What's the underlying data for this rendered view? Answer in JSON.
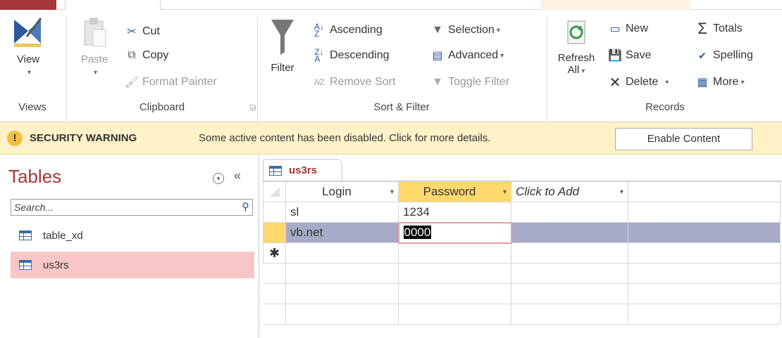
{
  "ribbon": {
    "groups": {
      "views": "Views",
      "clipboard": "Clipboard",
      "sort_filter": "Sort & Filter",
      "records": "Records"
    },
    "views": {
      "view_label": "View"
    },
    "clipboard": {
      "paste_label": "Paste",
      "cut_label": "Cut",
      "copy_label": "Copy",
      "format_painter_label": "Format Painter"
    },
    "sort_filter": {
      "filter_label": "Filter",
      "ascending_label": "Ascending",
      "descending_label": "Descending",
      "remove_sort_label": "Remove Sort",
      "selection_label": "Selection",
      "advanced_label": "Advanced",
      "toggle_filter_label": "Toggle Filter"
    },
    "records": {
      "refresh_label": "Refresh",
      "refresh_all_label": "All",
      "new_label": "New",
      "save_label": "Save",
      "delete_label": "Delete",
      "totals_label": "Totals",
      "spelling_label": "Spelling",
      "more_label": "More"
    }
  },
  "security": {
    "title": "SECURITY WARNING",
    "message": "Some active content has been disabled. Click for more details.",
    "enable_label": "Enable Content"
  },
  "nav": {
    "title": "Tables",
    "search_placeholder": "Search...",
    "items": [
      {
        "label": "table_xd"
      },
      {
        "label": "us3rs"
      }
    ]
  },
  "datasheet": {
    "tab_label": "us3rs",
    "columns": [
      "Login",
      "Password",
      "Click to Add"
    ],
    "rows": [
      {
        "login": "sl",
        "password": "1234"
      },
      {
        "login": "vb.net",
        "password": "0000"
      }
    ]
  },
  "colors": {
    "accent": "#a4373a",
    "warning_bar": "#fff2c8",
    "selected_nav": "#f8c6c6",
    "active_column_header": "#ffd86b",
    "active_row": "#a7abc8"
  }
}
